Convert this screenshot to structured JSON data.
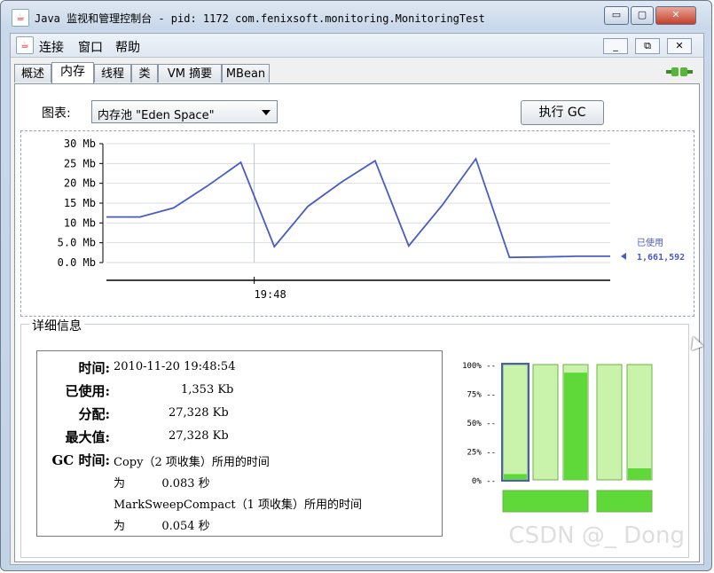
{
  "window": {
    "title": "Java 监视和管理控制台 - pid: 1172 com.fenixsoft.monitoring.MonitoringTest",
    "icon": "java-cup-icon",
    "controls": [
      "minimize",
      "maximize",
      "close"
    ]
  },
  "menu": [
    "连接",
    "窗口",
    "帮助"
  ],
  "tabs": [
    "概述",
    "内存",
    "线程",
    "类",
    "VM 摘要",
    "MBean"
  ],
  "active_tab": "内存",
  "chart_selector": {
    "label": "图表:",
    "value": "内存池 \"Eden Space\""
  },
  "gc_button": "执行 GC",
  "chart_data": {
    "type": "line",
    "y_ticks": [
      "30 Mb",
      "25 Mb",
      "20 Mb",
      "15 Mb",
      "10 Mb",
      "5.0 Mb",
      "0.0 Mb"
    ],
    "ylim": [
      0,
      30
    ],
    "x_tick": "19:48",
    "x": [
      0,
      1,
      2,
      3,
      4,
      5,
      6,
      7,
      8,
      9,
      10,
      11,
      12,
      13,
      14,
      15
    ],
    "series": [
      {
        "name": "已使用",
        "values": [
          11.5,
          11.5,
          13.8,
          19.3,
          25.3,
          4.0,
          14.2,
          20.3,
          25.7,
          4.2,
          14.5,
          26.2,
          1.3,
          1.4,
          1.6,
          1.6
        ]
      }
    ],
    "legend_value": "1,661,592",
    "color": "#4a5bc4"
  },
  "details": {
    "title": "详细信息",
    "rows": [
      {
        "key": "时间:",
        "value": "2010-11-20 19:48:54"
      },
      {
        "key": "已使用:",
        "value": "1,353 Kb"
      },
      {
        "key": "分配:",
        "value": "27,328 Kb"
      },
      {
        "key": "最大值:",
        "value": "27,328 Kb"
      }
    ],
    "gc_key": "GC 时间:",
    "gc_lines": [
      "Copy（2 项收集）所用的时间",
      "为          0.083 秒",
      "MarkSweepCompact（1 项收集）所用的时间",
      "为          0.054 秒"
    ]
  },
  "pool_bars": {
    "ticks": [
      "100% --",
      "75% --",
      "50% --",
      "25% --",
      "0% --"
    ],
    "fills": [
      0.05,
      0.0,
      0.93,
      0.0,
      0.1
    ]
  },
  "watermark": "CSDN @_ Dong"
}
